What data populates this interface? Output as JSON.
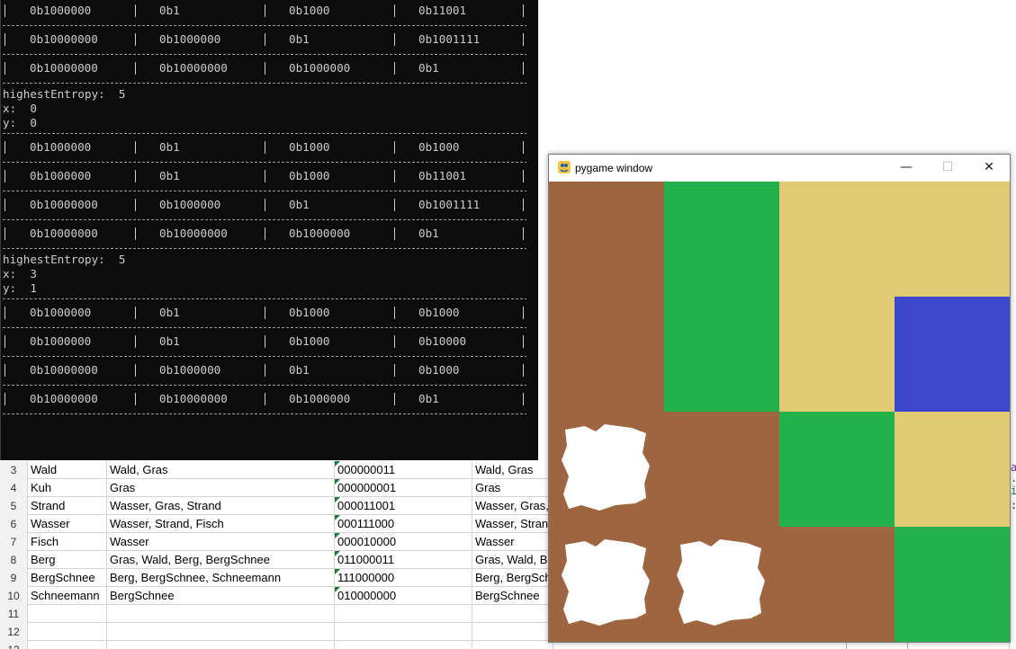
{
  "console": {
    "blocks": [
      {
        "kind": "row",
        "cells": [
          "0b1000000",
          "0b1",
          "0b1000",
          "0b11001"
        ]
      },
      {
        "kind": "row",
        "cells": [
          "0b10000000",
          "0b1000000",
          "0b1",
          "0b1001111"
        ]
      },
      {
        "kind": "row",
        "cells": [
          "0b10000000",
          "0b10000000",
          "0b1000000",
          "0b1"
        ]
      },
      {
        "kind": "info",
        "lines": [
          "highestEntropy:  5",
          "x:  0",
          "y:  0"
        ]
      },
      {
        "kind": "row",
        "cells": [
          "0b1000000",
          "0b1",
          "0b1000",
          "0b1000"
        ]
      },
      {
        "kind": "row",
        "cells": [
          "0b1000000",
          "0b1",
          "0b1000",
          "0b11001"
        ]
      },
      {
        "kind": "row",
        "cells": [
          "0b10000000",
          "0b1000000",
          "0b1",
          "0b1001111"
        ]
      },
      {
        "kind": "row",
        "cells": [
          "0b10000000",
          "0b10000000",
          "0b1000000",
          "0b1"
        ]
      },
      {
        "kind": "info",
        "lines": [
          "highestEntropy:  5",
          "x:  3",
          "y:  1"
        ]
      },
      {
        "kind": "row",
        "cells": [
          "0b1000000",
          "0b1",
          "0b1000",
          "0b1000"
        ]
      },
      {
        "kind": "row",
        "cells": [
          "0b1000000",
          "0b1",
          "0b1000",
          "0b10000"
        ]
      },
      {
        "kind": "row",
        "cells": [
          "0b10000000",
          "0b1000000",
          "0b1",
          "0b1000"
        ]
      },
      {
        "kind": "row",
        "cells": [
          "0b10000000",
          "0b10000000",
          "0b1000000",
          "0b1"
        ]
      }
    ]
  },
  "spreadsheet": {
    "rows": [
      {
        "num": "3",
        "a": "Wald",
        "b": "Wald, Gras",
        "c": "000000011",
        "d": "Wald, Gras"
      },
      {
        "num": "4",
        "a": "Kuh",
        "b": "Gras",
        "c": "000000001",
        "d": "Gras"
      },
      {
        "num": "5",
        "a": "Strand",
        "b": "Wasser, Gras, Strand",
        "c": "000011001",
        "d": "Wasser, Gras,"
      },
      {
        "num": "6",
        "a": "Wasser",
        "b": "Wasser, Strand, Fisch",
        "c": "000111000",
        "d": "Wasser, Stran"
      },
      {
        "num": "7",
        "a": "Fisch",
        "b": "Wasser",
        "c": "000010000",
        "d": "Wasser"
      },
      {
        "num": "8",
        "a": "Berg",
        "b": "Gras, Wald, Berg, BergSchnee",
        "c": "011000011",
        "d": "Gras, Wald, B"
      },
      {
        "num": "9",
        "a": "BergSchnee",
        "b": "Berg, BergSchnee, Schneemann",
        "c": "111000000",
        "d": "Berg, BergSch"
      },
      {
        "num": "10",
        "a": "Schneemann",
        "b": "BergSchnee",
        "c": "010000000",
        "d": "BergSchnee"
      },
      {
        "num": "11",
        "a": "",
        "b": "",
        "c": "",
        "d": ""
      },
      {
        "num": "12",
        "a": "",
        "b": "",
        "c": "",
        "d": ""
      },
      {
        "num": "13",
        "a": "",
        "b": "",
        "c": "",
        "d": ""
      }
    ]
  },
  "editor_fragment": {
    "glyphs": [
      "a",
      ".",
      "i",
      ":"
    ]
  },
  "pygame": {
    "title": "pygame window",
    "minimize_glyph": "—",
    "maximize_glyph": "☐",
    "close_glyph": "✕",
    "colors": {
      "brown": "#9e6541",
      "green": "#23b14d",
      "sand": "#e0cb72",
      "blue": "#3f48cc",
      "white": "#ffffff"
    },
    "grid": [
      [
        "brown",
        "green",
        "sand",
        "sand"
      ],
      [
        "brown",
        "green",
        "sand",
        "blue"
      ],
      [
        "brown-blob",
        "brown",
        "green",
        "sand"
      ],
      [
        "brown-blob",
        "brown-blob",
        "brown",
        "green"
      ]
    ]
  }
}
